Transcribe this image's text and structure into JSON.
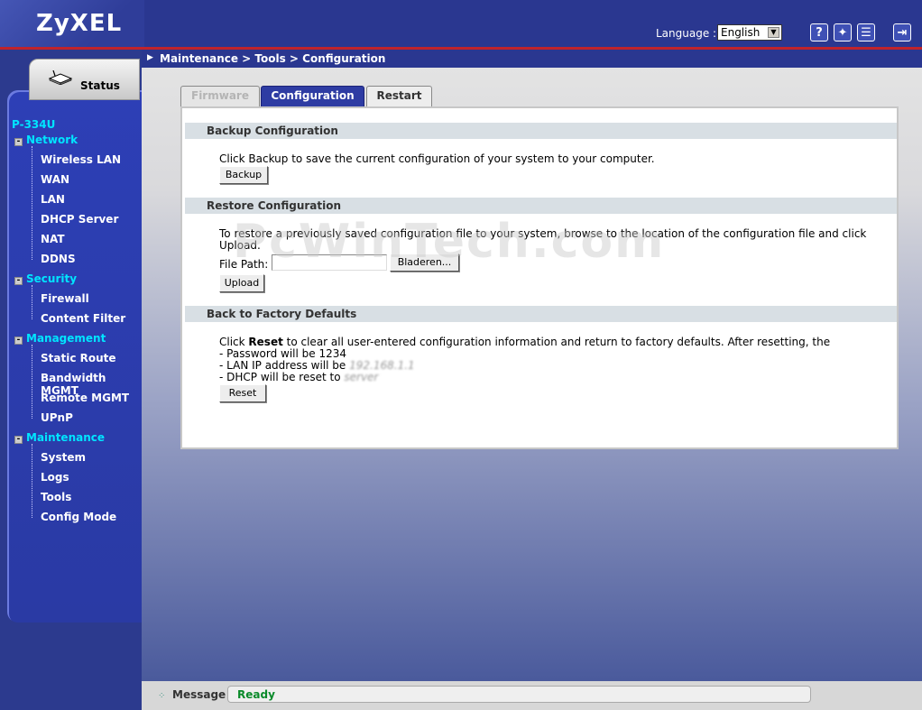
{
  "header": {
    "logo": "ZyXEL",
    "language_label": "Language :",
    "language_value": "English",
    "icons": [
      "help-icon",
      "wizard-icon",
      "notes-icon",
      "logout-icon"
    ]
  },
  "breadcrumb": "Maintenance > Tools > Configuration",
  "nav": {
    "status_label": "Status",
    "device": "P-334U",
    "groups": [
      {
        "label": "Network",
        "items": [
          "Wireless LAN",
          "WAN",
          "LAN",
          "DHCP Server",
          "NAT",
          "DDNS"
        ]
      },
      {
        "label": "Security",
        "items": [
          "Firewall",
          "Content Filter"
        ]
      },
      {
        "label": "Management",
        "items": [
          "Static Route",
          "Bandwidth MGMT",
          "Remote MGMT",
          "UPnP"
        ]
      },
      {
        "label": "Maintenance",
        "items": [
          "System",
          "Logs",
          "Tools",
          "Config Mode"
        ]
      }
    ]
  },
  "tabs": {
    "firmware": "Firmware",
    "configuration": "Configuration",
    "restart": "Restart"
  },
  "backup": {
    "title": "Backup Configuration",
    "text": "Click Backup to save the current configuration of your system to your computer.",
    "button": "Backup"
  },
  "restore": {
    "title": "Restore Configuration",
    "text_line1": "To restore a previously saved configuration file to your system, browse to the location of the configuration file and click",
    "text_line2": "Upload.",
    "file_path_label": "File Path:",
    "file_path_value": "",
    "browse_button": "Bladeren...",
    "upload_button": "Upload"
  },
  "factory": {
    "title": "Back to Factory Defaults",
    "line1_prefix": "Click ",
    "line1_bold": "Reset",
    "line1_suffix": " to clear all user-entered configuration information and return to factory defaults. After resetting, the",
    "line2": "- Password will be 1234",
    "line3": "- LAN IP address will be",
    "line3_obscured": "192.168.1.1",
    "line4": "- DHCP will be reset to",
    "line4_obscured": "server",
    "button": "Reset"
  },
  "watermark": "PcWinTech.com",
  "statusbar": {
    "label": "Message",
    "value": "Ready"
  },
  "colors": {
    "header_bg": "#2a3790",
    "accent_red": "#c0232b",
    "nav_text": "#00e5ff",
    "ready_green": "#0a8a2a"
  }
}
